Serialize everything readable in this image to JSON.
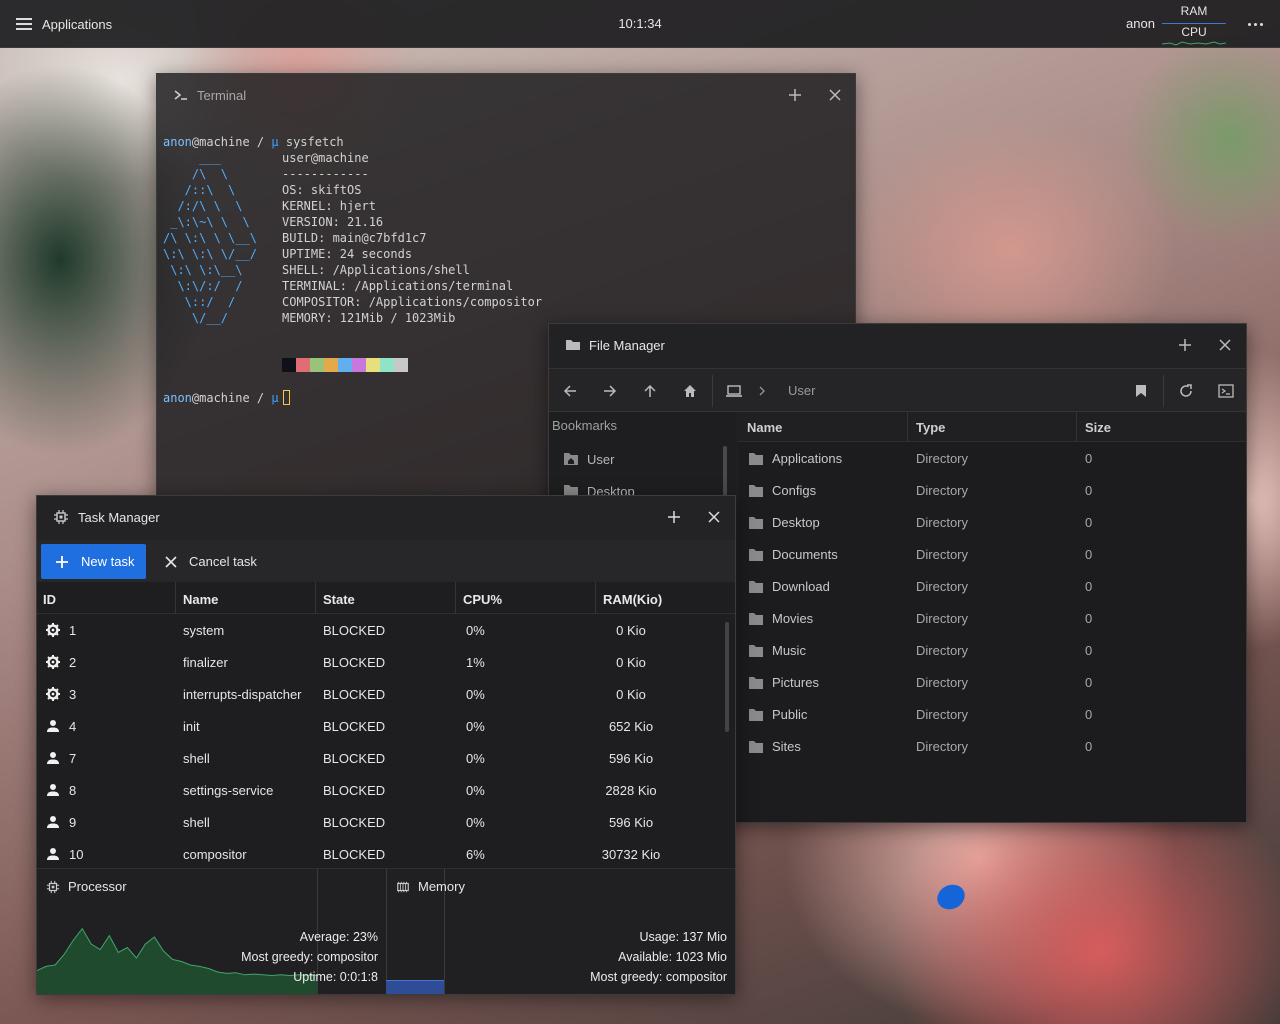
{
  "panel": {
    "apps_label": "Applications",
    "clock": "10:1:34",
    "user": "anon",
    "ram_label": "RAM",
    "cpu_label": "CPU"
  },
  "terminal": {
    "title": "Terminal",
    "prompt_user": "anon",
    "prompt_host": "@machine / ",
    "prompt_symbol": "µ",
    "command": "sysfetch",
    "logo_lines": [
      "     ___",
      "    /\\  \\",
      "   /::\\  \\",
      "  /:/\\ \\  \\",
      " _\\:\\~\\ \\  \\",
      "/\\ \\:\\ \\ \\__\\",
      "\\:\\ \\:\\ \\/__/",
      " \\:\\ \\:\\__\\",
      "  \\:\\/:/  /",
      "   \\::/  /",
      "    \\/__/"
    ],
    "info_lines": [
      "user@machine",
      "------------",
      "OS: skiftOS",
      "KERNEL: hjert",
      "VERSION: 21.16",
      "BUILD: main@c7bfd1c7",
      "UPTIME: 24 seconds",
      "SHELL: /Applications/shell",
      "TERMINAL: /Applications/terminal",
      "COMPOSITOR: /Applications/compositor",
      "MEMORY: 121Mib / 1023Mib"
    ],
    "palette": [
      "#101018",
      "#e06c75",
      "#98c379",
      "#e5a84b",
      "#61afef",
      "#c678dd",
      "#e5e07b",
      "#8fe3c8",
      "#c8c8c8"
    ]
  },
  "file_manager": {
    "title": "File Manager",
    "breadcrumb": "User",
    "sidebar_heading": "Bookmarks",
    "bookmarks": [
      "User",
      "Desktop"
    ],
    "columns": {
      "name": "Name",
      "type": "Type",
      "size": "Size"
    },
    "rows": [
      {
        "name": "Applications",
        "type": "Directory",
        "size": "0"
      },
      {
        "name": "Configs",
        "type": "Directory",
        "size": "0"
      },
      {
        "name": "Desktop",
        "type": "Directory",
        "size": "0"
      },
      {
        "name": "Documents",
        "type": "Directory",
        "size": "0"
      },
      {
        "name": "Download",
        "type": "Directory",
        "size": "0"
      },
      {
        "name": "Movies",
        "type": "Directory",
        "size": "0"
      },
      {
        "name": "Music",
        "type": "Directory",
        "size": "0"
      },
      {
        "name": "Pictures",
        "type": "Directory",
        "size": "0"
      },
      {
        "name": "Public",
        "type": "Directory",
        "size": "0"
      },
      {
        "name": "Sites",
        "type": "Directory",
        "size": "0"
      }
    ]
  },
  "task_manager": {
    "title": "Task Manager",
    "new_task_label": "New task",
    "cancel_task_label": "Cancel task",
    "columns": {
      "id": "ID",
      "name": "Name",
      "state": "State",
      "cpu": "CPU%",
      "ram": "RAM(Kio)"
    },
    "rows": [
      {
        "icon": "gear-icon",
        "id": "1",
        "name": "system",
        "state": "BLOCKED",
        "cpu": "0%",
        "ram": "0 Kio"
      },
      {
        "icon": "gear-icon",
        "id": "2",
        "name": "finalizer",
        "state": "BLOCKED",
        "cpu": "1%",
        "ram": "0 Kio"
      },
      {
        "icon": "gear-icon",
        "id": "3",
        "name": "interrupts-dispatcher",
        "state": "BLOCKED",
        "cpu": "0%",
        "ram": "0 Kio"
      },
      {
        "icon": "user-icon",
        "id": "4",
        "name": "init",
        "state": "BLOCKED",
        "cpu": "0%",
        "ram": "652 Kio"
      },
      {
        "icon": "user-icon",
        "id": "7",
        "name": "shell",
        "state": "BLOCKED",
        "cpu": "0%",
        "ram": "596 Kio"
      },
      {
        "icon": "user-icon",
        "id": "8",
        "name": "settings-service",
        "state": "BLOCKED",
        "cpu": "0%",
        "ram": "2828 Kio"
      },
      {
        "icon": "user-icon",
        "id": "9",
        "name": "shell",
        "state": "BLOCKED",
        "cpu": "0%",
        "ram": "596 Kio"
      },
      {
        "icon": "user-icon",
        "id": "10",
        "name": "compositor",
        "state": "BLOCKED",
        "cpu": "6%",
        "ram": "30732 Kio"
      }
    ],
    "processor": {
      "title": "Processor",
      "average": "Average: 23%",
      "greedy": "Most greedy: compositor",
      "uptime": "Uptime: 0:0:1:8",
      "history": [
        0.12,
        0.18,
        0.2,
        0.35,
        0.55,
        0.72,
        0.5,
        0.42,
        0.62,
        0.38,
        0.45,
        0.3,
        0.5,
        0.6,
        0.4,
        0.28,
        0.25,
        0.2,
        0.18,
        0.15,
        0.1,
        0.08,
        0.09,
        0.06,
        0.07,
        0.06,
        0.05,
        0.06,
        0.05,
        0.06,
        0.05,
        0.05
      ]
    },
    "memory": {
      "title": "Memory",
      "usage": "Usage: 137 Mio",
      "available": "Available: 1023 Mio",
      "greedy": "Most greedy: compositor",
      "fill": 0.13
    }
  }
}
